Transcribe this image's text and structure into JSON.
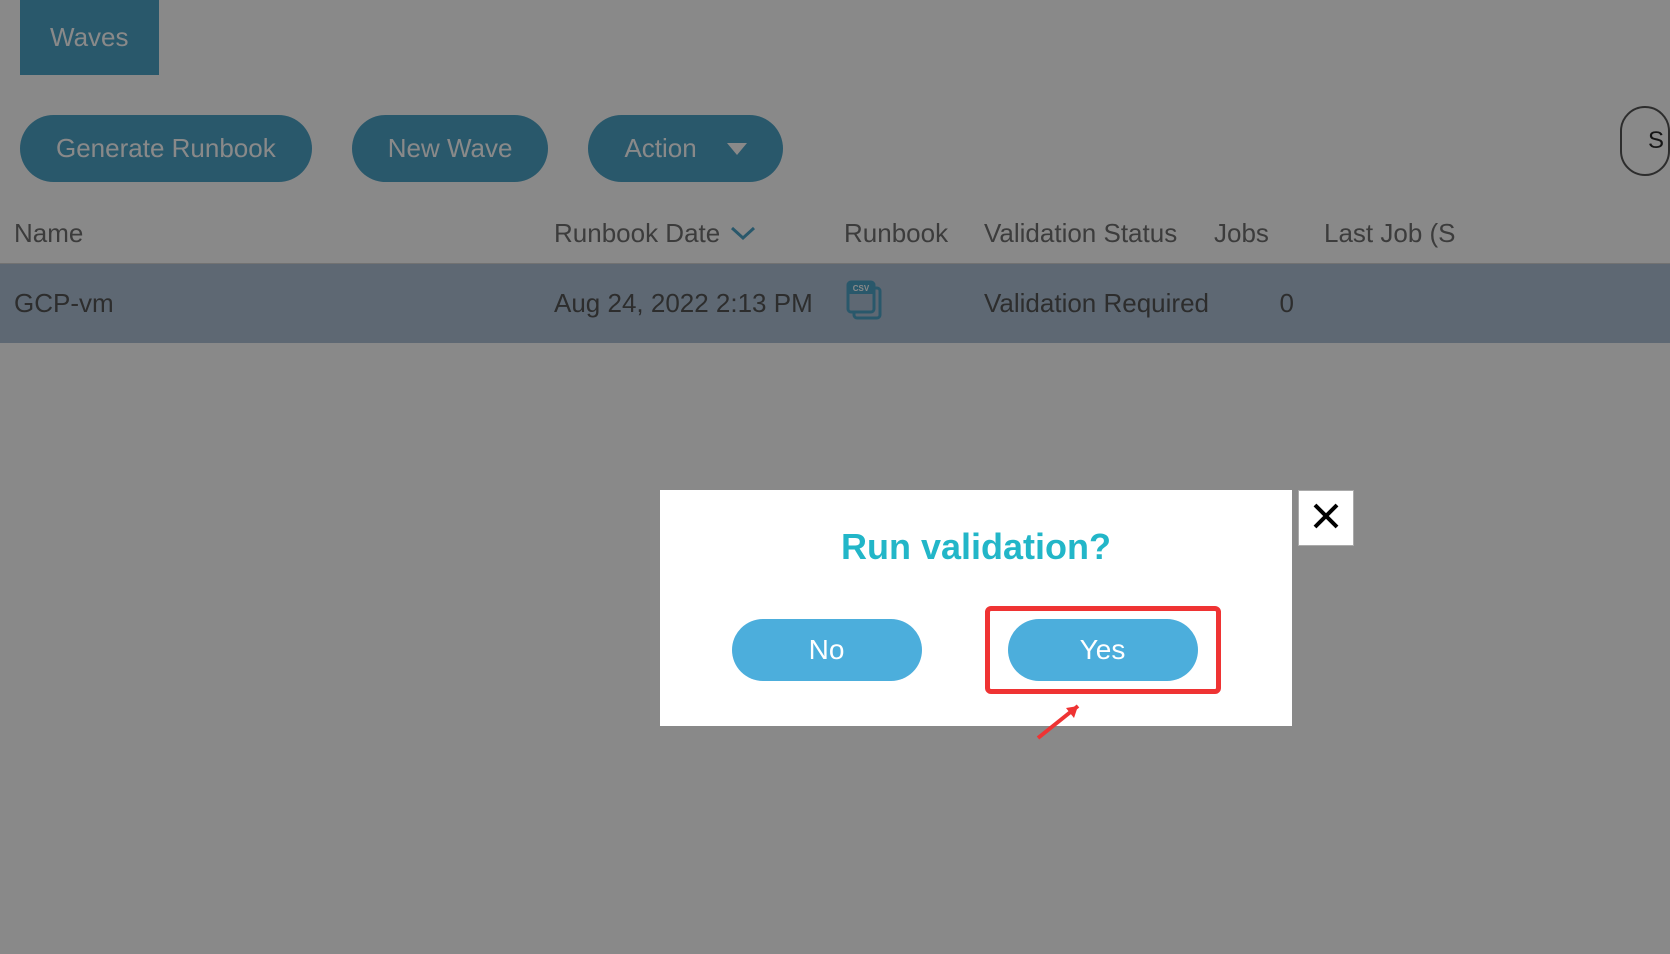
{
  "tab": {
    "label": "Waves"
  },
  "toolbar": {
    "generate": "Generate Runbook",
    "newWave": "New Wave",
    "action": "Action"
  },
  "columns": {
    "name": "Name",
    "runbookDate": "Runbook Date",
    "runbook": "Runbook",
    "validationStatus": "Validation Status",
    "jobs": "Jobs",
    "lastJob": "Last Job (S"
  },
  "rows": [
    {
      "name": "GCP-vm",
      "runbookDate": "Aug 24, 2022 2:13 PM",
      "validationStatus": "Validation Required",
      "jobs": "0"
    }
  ],
  "modal": {
    "title": "Run validation?",
    "no": "No",
    "yes": "Yes"
  }
}
